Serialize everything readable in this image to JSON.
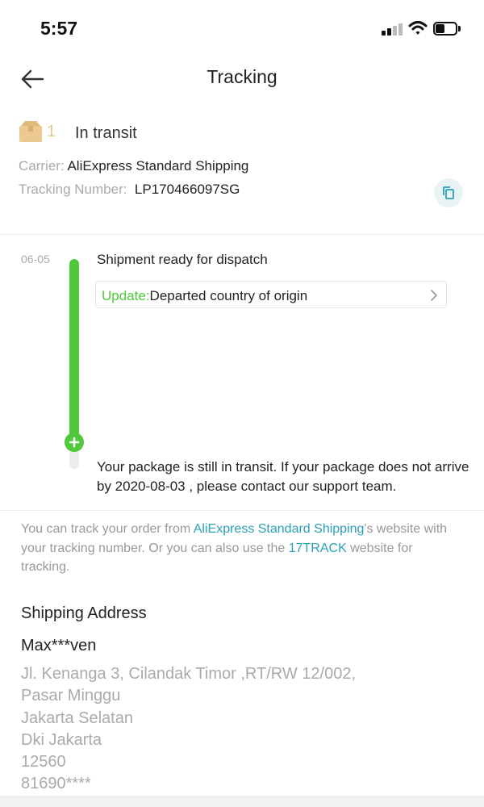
{
  "status_bar": {
    "time": "5:57"
  },
  "header": {
    "title": "Tracking"
  },
  "summary": {
    "package_count": "1",
    "status": "In transit",
    "carrier_label": "Carrier:",
    "carrier_value": "AliExpress Standard Shipping",
    "tracking_label": "Tracking Number:",
    "tracking_value": "LP170466097SG"
  },
  "timeline": {
    "event_date": "06-05",
    "event_title": "Shipment ready for dispatch",
    "update_label": "Update:",
    "update_text": "Departed country of origin",
    "transit_note": "Your package is still in transit. If your package does not arrive by 2020-08-03 , please contact our support team."
  },
  "info": {
    "text_1": "You can track your order from ",
    "carrier_link": "AliExpress Standard Shipping",
    "text_2": "'s website with your tracking number. Or you can also use the ",
    "tracker_link": "17TRACK",
    "text_3": " website for tracking."
  },
  "shipping_address": {
    "heading": "Shipping Address",
    "recipient": "Max***ven",
    "lines": [
      "Jl. Kenanga 3, Cilandak Timor ,RT/RW 12/002,",
      "Pasar Minggu",
      "Jakarta Selatan",
      "Dki Jakarta",
      "12560",
      "81690****"
    ]
  },
  "colors": {
    "accent_green": "#4fc93b",
    "link_blue": "#2b9fb8",
    "package_tan": "#e8c987"
  },
  "icons": [
    "signal-icon",
    "wifi-icon",
    "battery-icon",
    "back-arrow-icon",
    "package-box-icon",
    "copy-icon",
    "chevron-right-icon",
    "plus-icon"
  ]
}
